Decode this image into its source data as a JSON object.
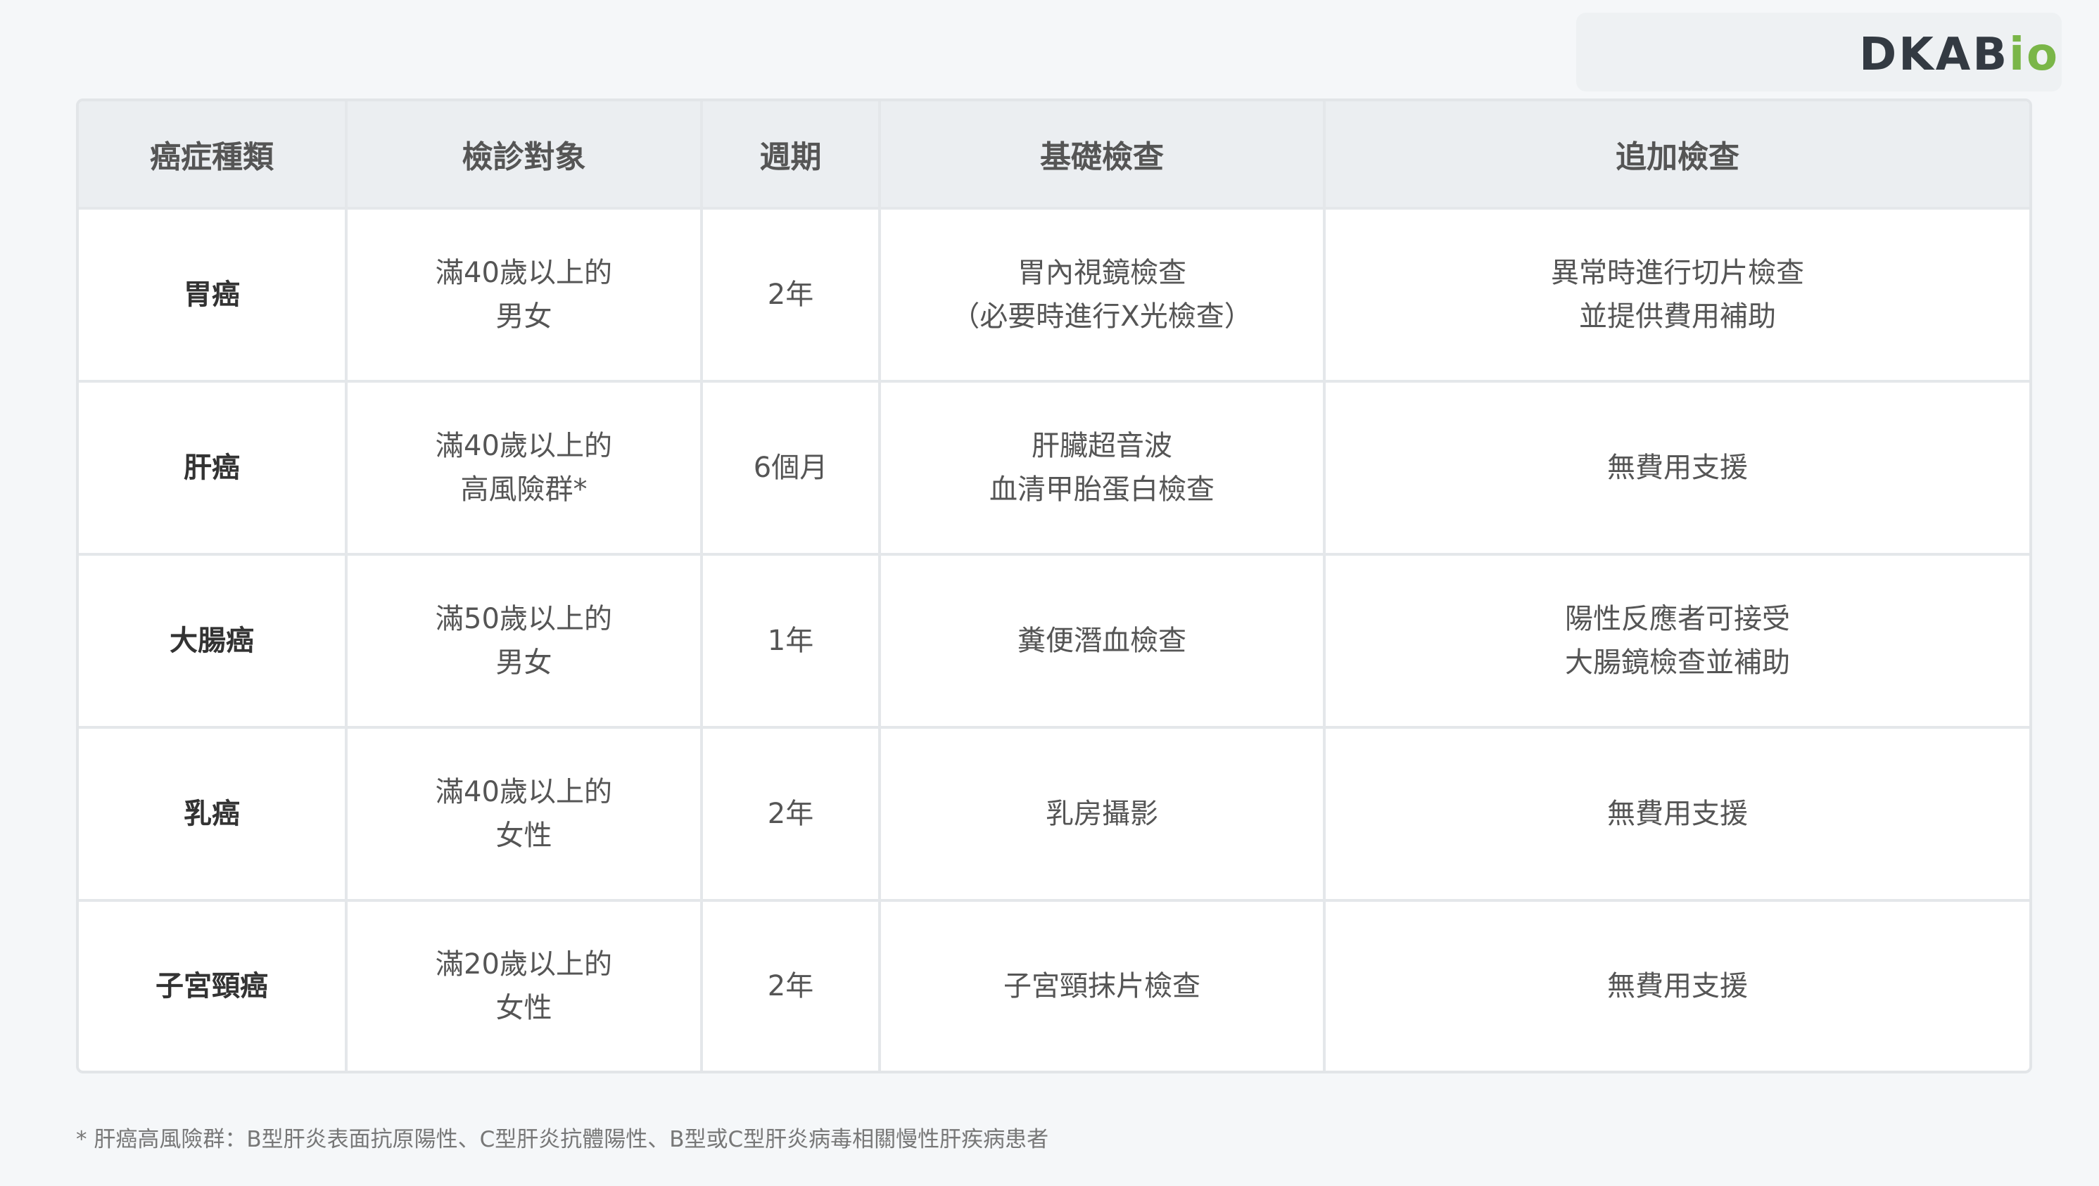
{
  "brand": {
    "logo_main": "DKAB",
    "logo_suffix": "io",
    "logo_color": "#333a42",
    "accent_color": "#7ab648"
  },
  "table": {
    "headers": [
      "癌症種類",
      "檢診對象",
      "週期",
      "基礎檢查",
      "追加檢查"
    ],
    "rows": [
      {
        "type": "胃癌",
        "target": [
          "滿40歲以上的",
          "男女"
        ],
        "period": "2年",
        "basic": [
          "胃內視鏡檢查",
          "（必要時進行X光檢查）"
        ],
        "additional": [
          "異常時進行切片檢查",
          "並提供費用補助"
        ]
      },
      {
        "type": "肝癌",
        "target": [
          "滿40歲以上的",
          "高風險群*"
        ],
        "period": "6個月",
        "basic": [
          "肝臟超音波",
          "血清甲胎蛋白檢查"
        ],
        "additional": [
          "無費用支援"
        ]
      },
      {
        "type": "大腸癌",
        "target": [
          "滿50歲以上的",
          "男女"
        ],
        "period": "1年",
        "basic": [
          "糞便潛血檢查"
        ],
        "additional": [
          "陽性反應者可接受",
          "大腸鏡檢查並補助"
        ]
      },
      {
        "type": "乳癌",
        "target": [
          "滿40歲以上的",
          "女性"
        ],
        "period": "2年",
        "basic": [
          "乳房攝影"
        ],
        "additional": [
          "無費用支援"
        ]
      },
      {
        "type": "子宮頸癌",
        "target": [
          "滿20歲以上的",
          "女性"
        ],
        "period": "2年",
        "basic": [
          "子宮頸抹片檢查"
        ],
        "additional": [
          "無費用支援"
        ]
      }
    ]
  },
  "footnote": "* 肝癌高風險群：B型肝炎表面抗原陽性、C型肝炎抗體陽性、B型或C型肝炎病毒相關慢性肝疾病患者"
}
